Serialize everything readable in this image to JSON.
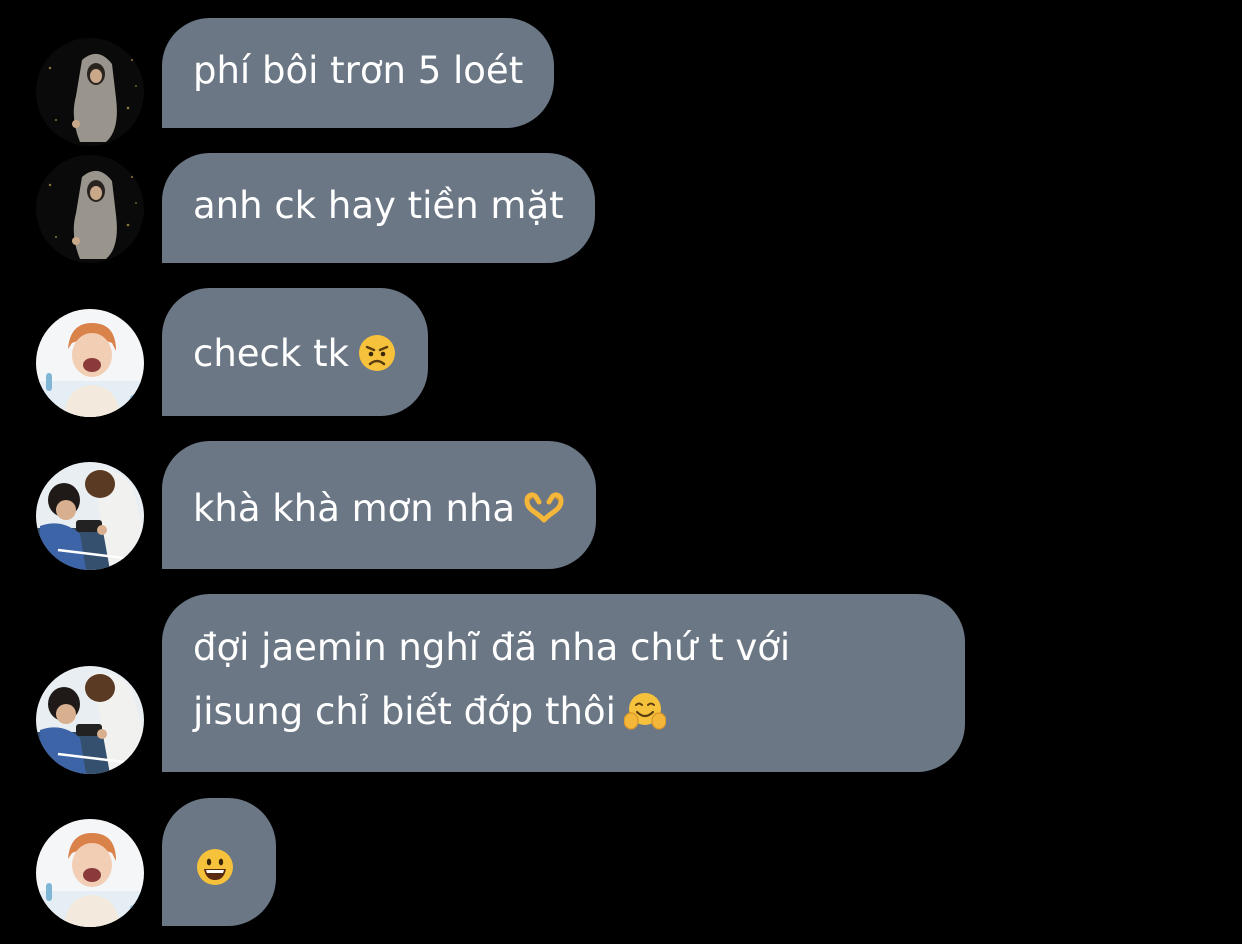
{
  "messages": [
    {
      "avatar": "dark-hooded-figure-avatar",
      "text": "phí bôi trơn 5 loét"
    },
    {
      "avatar": "dark-hooded-figure-avatar",
      "text": "anh ck hay tiền mặt"
    },
    {
      "avatar": "orange-hair-smiling-avatar",
      "text": "check tk",
      "emoji": "angry-face-emoji"
    },
    {
      "avatar": "two-people-phone-avatar",
      "text": "khà khà mơn nha",
      "emoji": "heart-hands-emoji"
    },
    {
      "avatar": "two-people-phone-avatar",
      "lines": [
        "đợi jaemin nghĩ đã nha chứ t với",
        "jisung chỉ biết đớp thôi"
      ],
      "emoji": "hugging-face-emoji"
    },
    {
      "avatar": "orange-hair-smiling-avatar",
      "emoji": "grinning-face-emoji"
    }
  ],
  "colors": {
    "background": "#000000",
    "bubble": "#6b7785",
    "text": "#ffffff"
  }
}
